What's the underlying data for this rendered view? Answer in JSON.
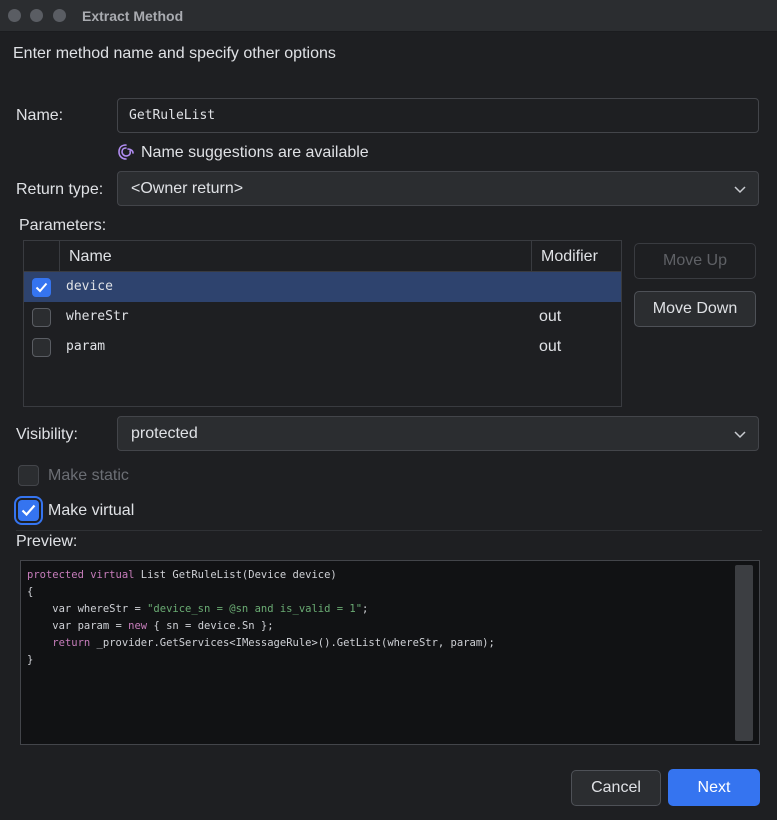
{
  "window": {
    "title": "Extract Method"
  },
  "header": {
    "subtitle": "Enter method name and specify other options"
  },
  "form": {
    "name_label": "Name:",
    "name_value": "GetRuleList",
    "suggestion": "Name suggestions are available",
    "return_type_label": "Return type:",
    "return_type_value": "<Owner return>",
    "parameters_label": "Parameters:",
    "visibility_label": "Visibility:",
    "visibility_value": "protected",
    "make_static_label": "Make static",
    "make_static_checked": false,
    "make_virtual_label": "Make virtual",
    "make_virtual_checked": true,
    "preview_label": "Preview:"
  },
  "parameters": {
    "columns": [
      "Name",
      "Modifier"
    ],
    "rows": [
      {
        "name": "device",
        "modifier": "",
        "checked": true,
        "selected": true
      },
      {
        "name": "whereStr",
        "modifier": "out",
        "checked": false,
        "selected": false
      },
      {
        "name": "param",
        "modifier": "out",
        "checked": false,
        "selected": false
      }
    ]
  },
  "side_buttons": {
    "move_up": "Move Up",
    "move_down": "Move Down"
  },
  "preview": {
    "lines": [
      "protected virtual List GetRuleList(Device device)",
      "{",
      "    var whereStr = \"device_sn = @sn and is_valid = 1\";",
      "    var param = new { sn = device.Sn };",
      "    return _provider.GetServices<IMessageRule>().GetList(whereStr, param);",
      "}"
    ]
  },
  "footer": {
    "cancel": "Cancel",
    "next": "Next"
  },
  "colors": {
    "accent": "#3574f0",
    "background": "#1e1f22",
    "selected_row": "#2e436e"
  }
}
